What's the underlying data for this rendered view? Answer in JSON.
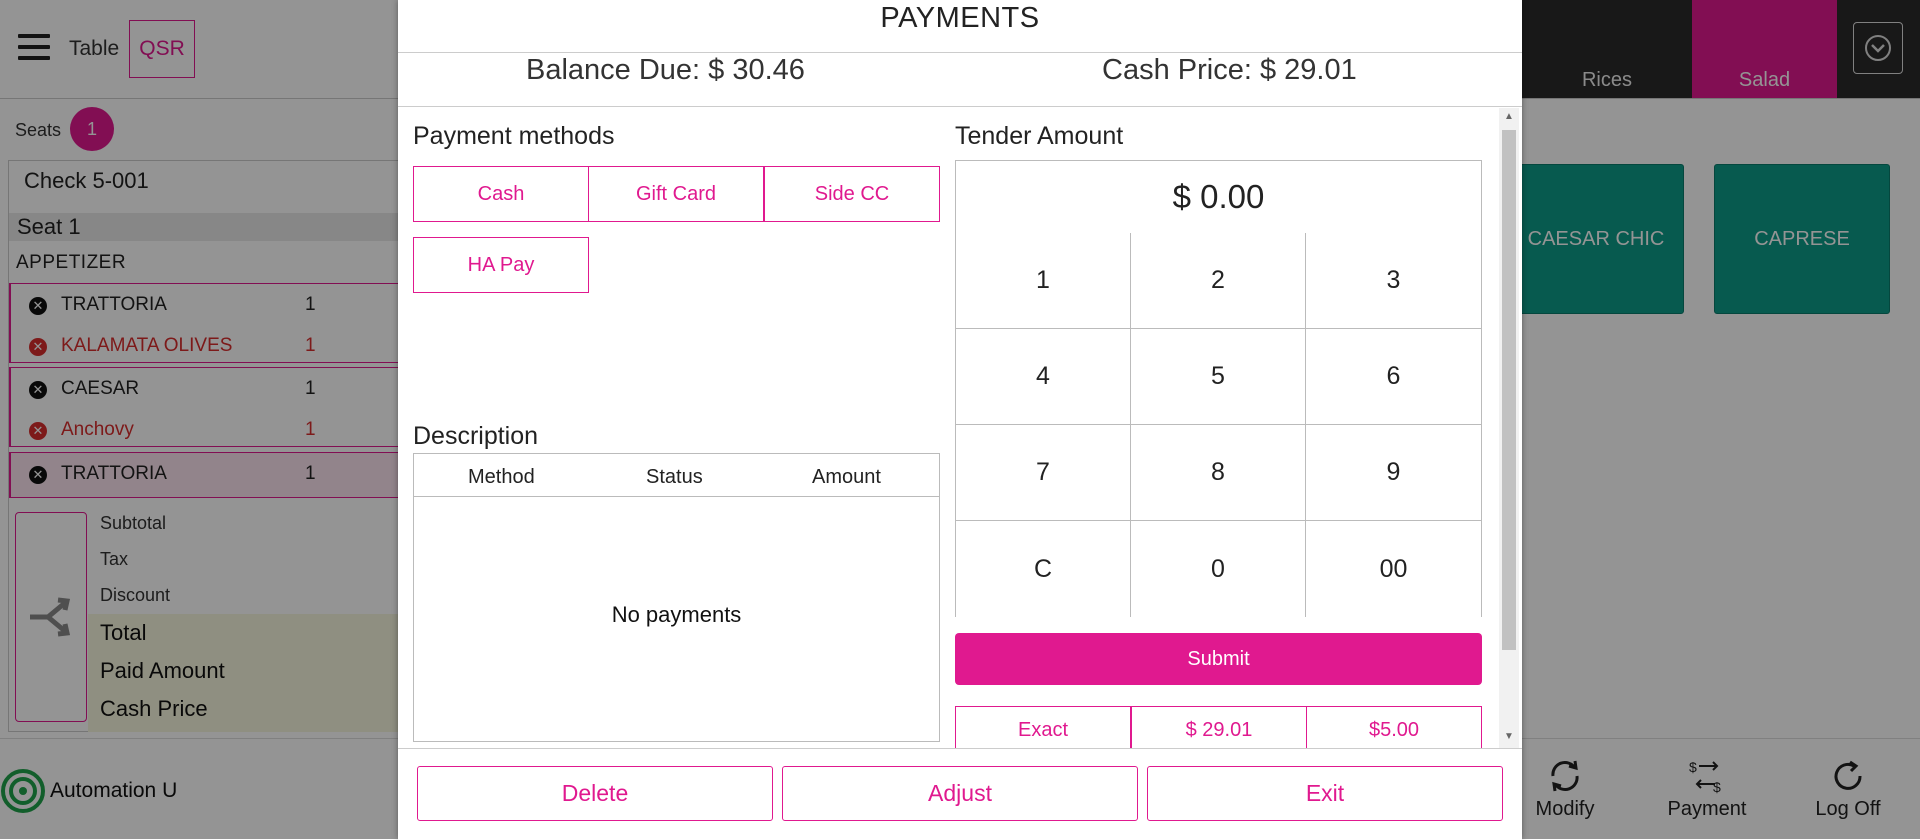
{
  "header": {
    "table_label": "Table",
    "qsr_label": "QSR",
    "categories": [
      {
        "label": "Rices"
      },
      {
        "label": "Salad"
      }
    ]
  },
  "seats": {
    "label": "Seats",
    "count": "1"
  },
  "check": {
    "title": "Check",
    "number": "5-001",
    "seat_label": "Seat 1",
    "category": "APPETIZER",
    "items": [
      {
        "name": "TRATTORIA",
        "qty": "1"
      },
      {
        "name": "KALAMATA OLIVES",
        "qty": "1"
      },
      {
        "name": "CAESAR",
        "qty": "1"
      },
      {
        "name": "Anchovy",
        "qty": "1"
      },
      {
        "name": "TRATTORIA",
        "qty": "1"
      }
    ],
    "totals": {
      "subtotal": "Subtotal",
      "tax": "Tax",
      "discount": "Discount",
      "total": "Total",
      "paid_amount": "Paid Amount",
      "cash_price": "Cash Price"
    }
  },
  "menu_tiles": [
    {
      "label": "CAESAR CHIC"
    },
    {
      "label": "CAPRESE"
    }
  ],
  "footer": {
    "user": "Automation U",
    "modify": "Modify",
    "payment": "Payment",
    "log_off": "Log Off"
  },
  "modal": {
    "title": "PAYMENTS",
    "balance_due": "Balance Due: $ 30.46",
    "cash_price": "Cash Price: $ 29.01",
    "payment_methods_title": "Payment methods",
    "payment_methods": [
      "Cash",
      "Gift Card",
      "Side CC",
      "HA Pay"
    ],
    "description_title": "Description",
    "table_headers": {
      "method": "Method",
      "status": "Status",
      "amount": "Amount"
    },
    "empty_text": "No payments",
    "tender_title": "Tender Amount",
    "tender_amount": "$ 0.00",
    "keypad": [
      "1",
      "2",
      "3",
      "4",
      "5",
      "6",
      "7",
      "8",
      "9",
      "C",
      "0",
      "00"
    ],
    "submit": "Submit",
    "quick_amounts": [
      "Exact",
      "$ 29.01",
      "$5.00"
    ],
    "buttons": {
      "delete": "Delete",
      "adjust": "Adjust",
      "exit": "Exit"
    }
  },
  "colors": {
    "accent": "#e0198f",
    "tile": "#0d9b88",
    "danger": "#d72d2d",
    "dim_overlay": "rgba(0,0,0,0.42)"
  }
}
